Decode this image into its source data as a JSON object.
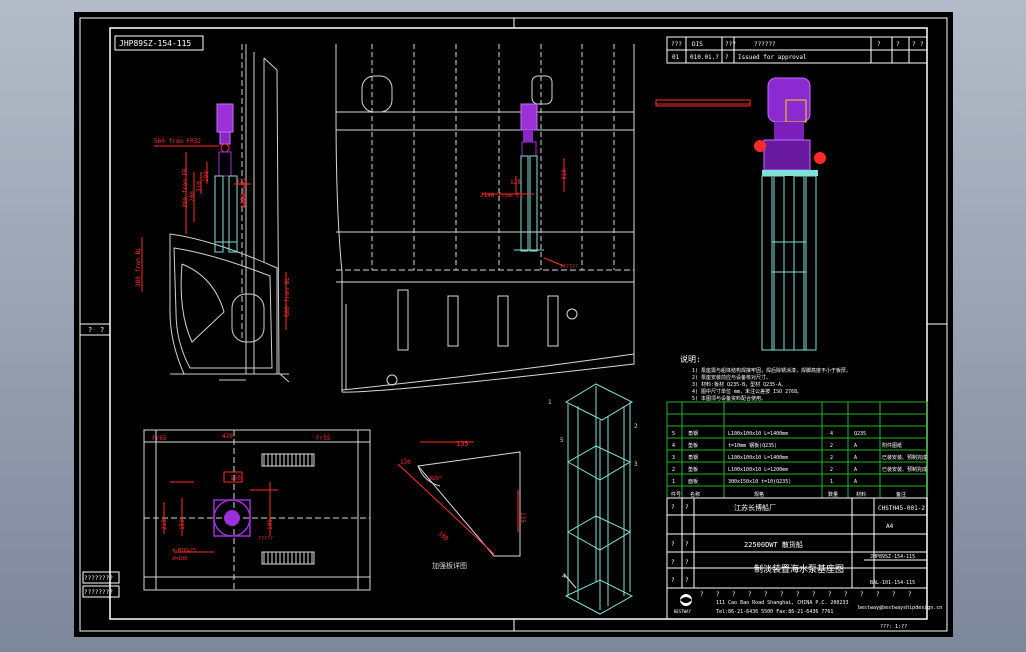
{
  "drawing": {
    "ref_top_left": "JHP89SZ-154-115",
    "rev_header": [
      "???",
      "DIS",
      "???",
      "??????",
      "?",
      "?",
      "?",
      "?"
    ],
    "rev_row": [
      "01",
      "010.01.?",
      "?",
      "Issued for approval"
    ],
    "row_label_left": [
      "?",
      "?"
    ],
    "stamp_labels": [
      "????????",
      "????????"
    ],
    "scale_text": "1:20",
    "zoom_label": "???: 1:??"
  },
  "view_side": {
    "dims": [
      "560 from FR32",
      "380 from FR",
      "200",
      "310",
      "100",
      "135",
      "150",
      "1350",
      "510"
    ],
    "left_label": "380 from BL",
    "right_label": "680 from BL"
  },
  "view_section": {
    "dims": [
      "310",
      "125",
      "210",
      "2148 from CL"
    ],
    "callout": "??????"
  },
  "view_plan": {
    "dims": [
      "Fr65",
      "Fr55",
      "470",
      "150",
      "100",
      "250",
      "150",
      "210",
      "150"
    ],
    "notes": [
      "4-M16×25",
      "d=100",
      "d=150"
    ],
    "callout": "?????",
    "plan_frames": [
      "220",
      "100"
    ]
  },
  "view_detail": {
    "dims": [
      "135",
      "130",
      "135",
      "180"
    ],
    "angle": "R20°",
    "caption": "加强板详图"
  },
  "iso_labels": [
    "1",
    "2",
    "3",
    "4",
    "5"
  ],
  "notes": {
    "title": "说明:",
    "lines": [
      "1) 泵座需与船体结构焊接牢固，焊后除锈涂漆，焊脚高度不小于板厚。",
      "2) 泵座安装前应与设备核对尺寸。",
      "3) 材料:板材 Q235-B，型材 Q235-A。",
      "4) 图中尺寸单位 mm，未注公差按 ISO 2768。",
      "5) 本图须与设备资料配合使用。"
    ]
  },
  "parts_table": {
    "headers": [
      "件号",
      "名称",
      "规格",
      "数量",
      "材料",
      "备注"
    ],
    "rows": [
      [
        "5",
        "角钢",
        "L100x100x10 L=1400mm",
        "4",
        "Q235",
        ""
      ],
      [
        "4",
        "垫板",
        "t=10mm 钢板(Q235)",
        "2",
        "A",
        "附件图纸"
      ],
      [
        "3",
        "角钢",
        "L100x100x10 L=1400mm",
        "2",
        "A",
        "已装安装、预制完成"
      ],
      [
        "2",
        "垫板",
        "L100x100x10 L=1200mm",
        "2",
        "A",
        "已装安装、预制完成"
      ],
      [
        "1",
        "面板",
        "300x150x10 t=10(Q235)",
        "1",
        "A",
        ""
      ]
    ]
  },
  "title_block": {
    "company": "江苏长博船厂",
    "project": "22500DWT 散货船",
    "title": "制淡装置海水泵基座图",
    "drawing_no": "CHSTH45-001-2",
    "sheet": "A4",
    "drawing_no2": "JHP89SZ-154-115",
    "code": "BAL-101-154-115",
    "label_cells": [
      "?",
      "?",
      "?",
      "?",
      "?",
      "?",
      "?",
      "?"
    ],
    "bottom_row": [
      "?",
      "?",
      "?",
      "?",
      "?",
      "?",
      "?",
      "?",
      "?",
      "?",
      "?",
      "?",
      "?",
      "?"
    ],
    "logo_text": "BESTWAY",
    "address": "111 Cao Bao Road Shanghai, CHINA  P.C. 200233",
    "tel": "Tel:86-21-6436 5500  Fax:86-21-6436 7761",
    "email": "bestway@bestwayshipdesign.cn"
  },
  "colors": {
    "frame": "#ffffff",
    "hull": "#d8d8d8",
    "dimension": "#ff2a2a",
    "pump": "#9b30d9",
    "structure": "#7fe0d8",
    "table_grid": "#1fb52a",
    "text": "#ffffff"
  }
}
